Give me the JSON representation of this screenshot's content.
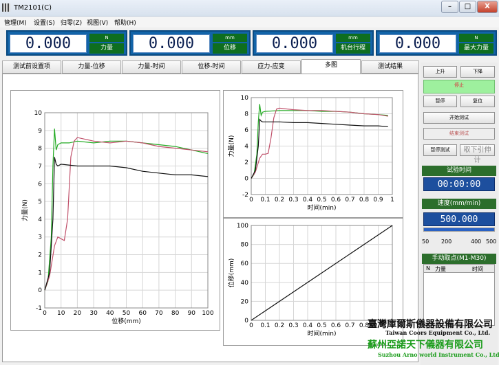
{
  "window": {
    "title": "TM2101(C)",
    "min": "–",
    "max": "□",
    "close": "X"
  },
  "menu": [
    "管理(M)",
    "设置(S)",
    "归零(Z)",
    "视图(V)",
    "帮助(H)"
  ],
  "readouts": [
    {
      "value": "0.000",
      "unit": "N",
      "label": "力量"
    },
    {
      "value": "0.000",
      "unit": "mm",
      "label": "位移"
    },
    {
      "value": "0.000",
      "unit": "mm",
      "label": "机台行程"
    },
    {
      "value": "0.000",
      "unit": "N",
      "label": "最大力量"
    }
  ],
  "tabs": [
    "测试前设置项",
    "力量-位移",
    "力量-时间",
    "位移-时间",
    "应力-应变",
    "多图",
    "测试结果"
  ],
  "active_tab": 5,
  "side": {
    "up": "上升",
    "down": "下降",
    "stop": "停止",
    "pause": "暂停",
    "reset": "复位",
    "start": "开始测试",
    "end": "结束测试",
    "pause_test": "暂停测试",
    "remove_extenso": "取下引伸计",
    "time_label": "试验时间",
    "time_value": "00:00:00",
    "speed_label": "速度(mm/min)",
    "speed_value": "500.000",
    "speed_ticks": [
      "50",
      "200",
      "400",
      "500"
    ],
    "speed_fraction": 1.0,
    "manual_label": "手动取点(M1-M30)",
    "manual_cols": [
      "N",
      "力量",
      "时间"
    ]
  },
  "watermark": {
    "line1": "臺灣庫爾斯儀器設備有限公司",
    "line2": "Taiwan Coors Equipment Co., Ltd.",
    "line3": "蘇州亞諾天下儀器有限公司",
    "line4": "Suzhou Arno world Instrument Co., Ltd."
  },
  "chart_data": [
    {
      "type": "line",
      "xlabel": "位移(mm)",
      "ylabel": "力量(N)",
      "xlim": [
        0,
        100
      ],
      "ylim": [
        -1,
        10
      ],
      "xticks": [
        0,
        10,
        20,
        30,
        40,
        50,
        60,
        70,
        80,
        90,
        100
      ],
      "yticks": [
        -1,
        0,
        1,
        2,
        3,
        4,
        5,
        6,
        7,
        8,
        9,
        10
      ],
      "grid": true,
      "series": [
        {
          "color": "#22aa22",
          "x": [
            0,
            2,
            4,
            5,
            6,
            7,
            8,
            10,
            15,
            20,
            30,
            40,
            50,
            60,
            70,
            80,
            90,
            100
          ],
          "y": [
            0,
            0.5,
            3,
            7,
            9.1,
            7.9,
            8.2,
            8.3,
            8.3,
            8.4,
            8.3,
            8.4,
            8.4,
            8.3,
            8.2,
            8.1,
            7.9,
            7.7
          ]
        },
        {
          "color": "#c0506a",
          "x": [
            0,
            3,
            6,
            8,
            10,
            12,
            14,
            16,
            18,
            20,
            25,
            30,
            40,
            50,
            60,
            70,
            80,
            90,
            100
          ],
          "y": [
            0,
            0.8,
            2.5,
            3,
            2.9,
            2.8,
            4,
            7.5,
            8.4,
            8.6,
            8.5,
            8.4,
            8.3,
            8.4,
            8.3,
            8.1,
            8.0,
            7.9,
            7.8
          ]
        },
        {
          "color": "#111111",
          "x": [
            0,
            3,
            5,
            6,
            7,
            8,
            10,
            20,
            30,
            40,
            50,
            60,
            70,
            80,
            90,
            100
          ],
          "y": [
            0,
            1,
            4,
            7.5,
            7.1,
            7.0,
            7.1,
            7.0,
            7.0,
            7.0,
            6.9,
            6.7,
            6.6,
            6.5,
            6.5,
            6.4
          ]
        }
      ]
    },
    {
      "type": "line",
      "xlabel": "时间(min)",
      "ylabel": "力量(N)",
      "xlim": [
        0,
        1
      ],
      "ylim": [
        -2,
        10
      ],
      "xticks": [
        0,
        0.1,
        0.2,
        0.3,
        0.4,
        0.5,
        0.6,
        0.7,
        0.8,
        0.9,
        1
      ],
      "yticks": [
        -2,
        0,
        2,
        4,
        6,
        8,
        10
      ],
      "grid": true,
      "series": [
        {
          "color": "#22aa22",
          "x": [
            0,
            0.02,
            0.04,
            0.05,
            0.06,
            0.07,
            0.08,
            0.1,
            0.2,
            0.3,
            0.4,
            0.5,
            0.6,
            0.7,
            0.8,
            0.9,
            0.97
          ],
          "y": [
            0,
            0.5,
            3,
            7,
            9.2,
            7.8,
            8.2,
            8.3,
            8.4,
            8.4,
            8.4,
            8.3,
            8.3,
            8.2,
            8.0,
            7.9,
            7.8
          ]
        },
        {
          "color": "#c0506a",
          "x": [
            0,
            0.03,
            0.06,
            0.08,
            0.1,
            0.12,
            0.14,
            0.16,
            0.18,
            0.2,
            0.3,
            0.4,
            0.5,
            0.6,
            0.7,
            0.8,
            0.9,
            0.97
          ],
          "y": [
            0,
            0.8,
            2.5,
            3,
            3,
            3.1,
            5,
            7.5,
            8.6,
            8.7,
            8.5,
            8.4,
            8.4,
            8.3,
            8.2,
            8.0,
            7.9,
            7.7
          ]
        },
        {
          "color": "#111111",
          "x": [
            0,
            0.03,
            0.05,
            0.06,
            0.07,
            0.08,
            0.1,
            0.2,
            0.3,
            0.4,
            0.5,
            0.6,
            0.7,
            0.8,
            0.9,
            0.97
          ],
          "y": [
            0,
            1,
            4,
            7.3,
            7.1,
            7.0,
            7.0,
            7.0,
            6.9,
            6.9,
            6.8,
            6.7,
            6.6,
            6.5,
            6.5,
            6.4
          ]
        }
      ]
    },
    {
      "type": "line",
      "xlabel": "时间(min)",
      "ylabel": "位移(mm)",
      "xlim": [
        0,
        1
      ],
      "ylim": [
        0,
        100
      ],
      "xticks": [
        0,
        0.1,
        0.2,
        0.3,
        0.4,
        0.5,
        0.6,
        0.7,
        0.8,
        0.9,
        1
      ],
      "yticks": [
        0,
        20,
        40,
        60,
        80,
        100
      ],
      "grid": true,
      "series": [
        {
          "color": "#111111",
          "x": [
            0,
            1
          ],
          "y": [
            0,
            100
          ]
        }
      ]
    }
  ]
}
